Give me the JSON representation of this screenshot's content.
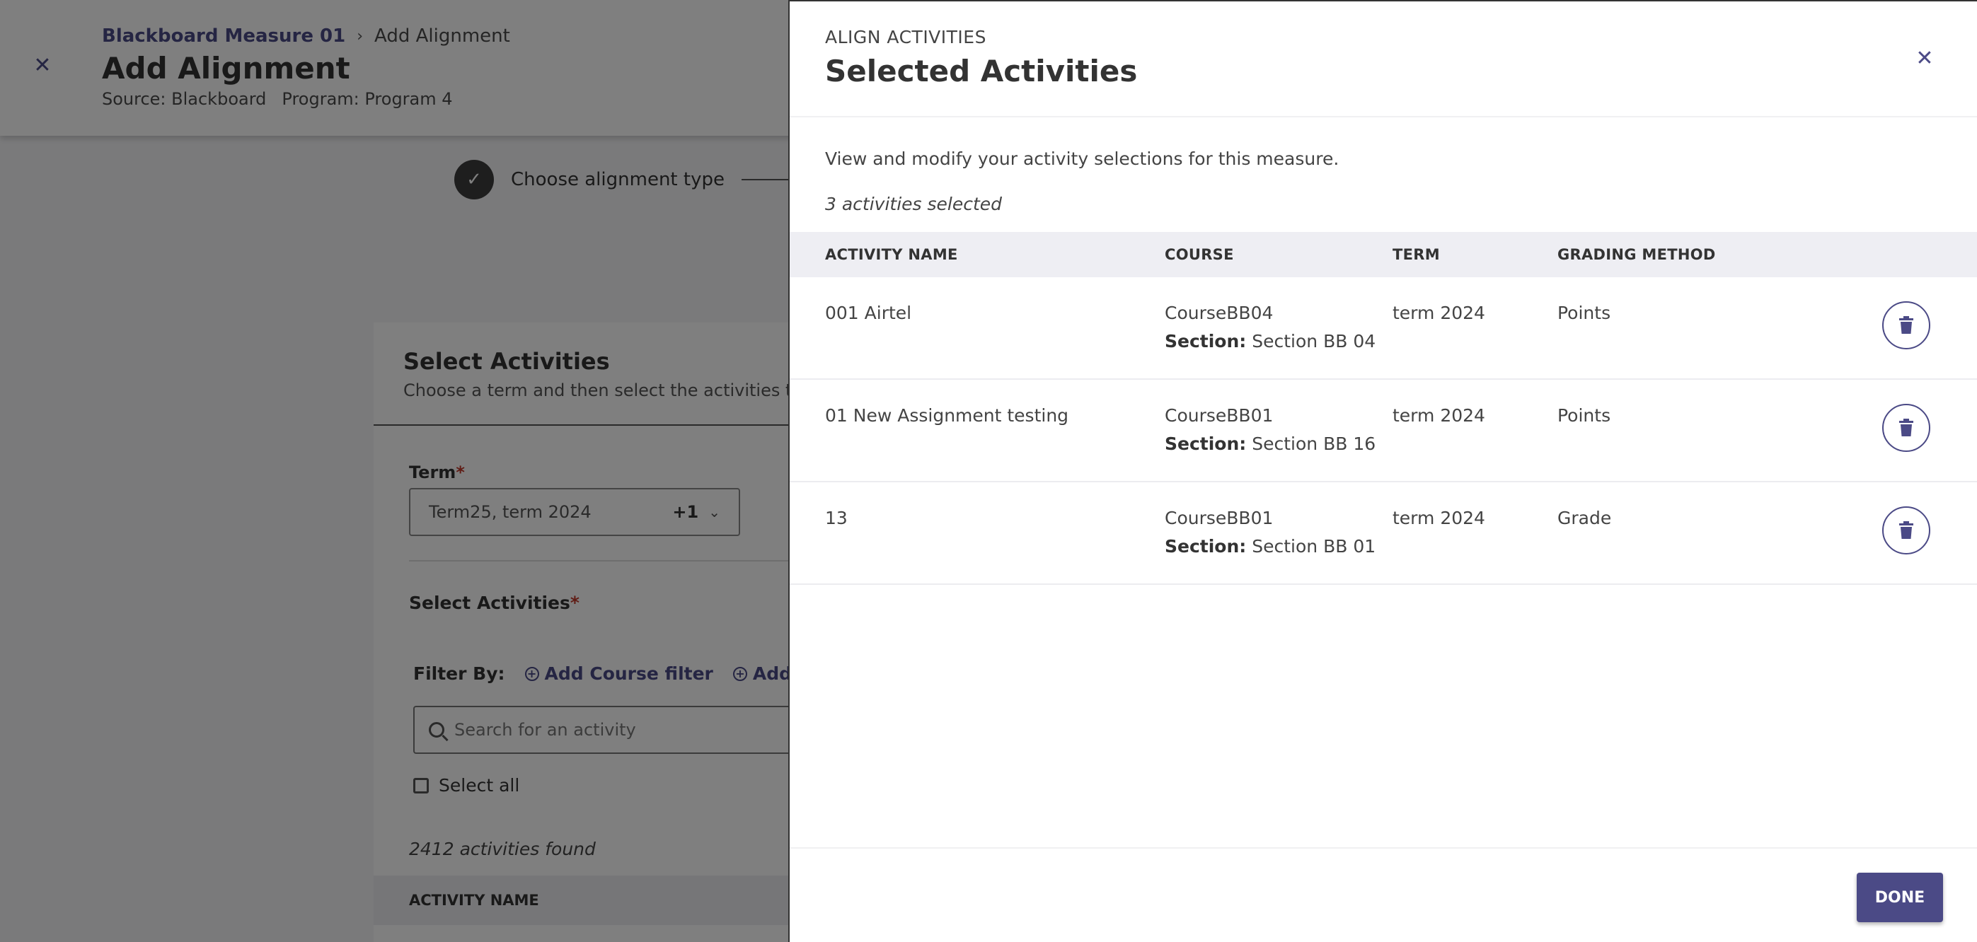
{
  "background": {
    "breadcrumb": {
      "parent": "Blackboard Measure 01",
      "separator": "›",
      "current": "Add Alignment"
    },
    "title": "Add Alignment",
    "meta": {
      "source": "Source: Blackboard",
      "program": "Program: Program 4"
    },
    "stepper": {
      "step1_label": "Choose alignment type",
      "step1_icon": "check-icon"
    },
    "card": {
      "title": "Select Activities",
      "subtitle": "Choose a term and then select the activities that",
      "term_label": "Term",
      "term_value": "Term25, term 2024",
      "term_extra": "+1",
      "select_label": "Select Activities",
      "filter_label": "Filter By:",
      "filter_course": "Add Course filter",
      "filter_section": "Add Secti",
      "search_placeholder": "Search for an activity",
      "select_all": "Select all",
      "found": "2412 activities found",
      "col_name": "ACTIVITY NAME"
    }
  },
  "panel": {
    "eyebrow": "ALIGN ACTIVITIES",
    "title": "Selected Activities",
    "description": "View and modify your activity selections for this measure.",
    "count": "3 activities selected",
    "columns": {
      "name": "ACTIVITY NAME",
      "course": "COURSE",
      "term": "TERM",
      "grading": "GRADING METHOD"
    },
    "section_label": "Section:",
    "rows": [
      {
        "name": "001 Airtel",
        "course": "CourseBB04",
        "section": "Section BB 04",
        "term": "term 2024",
        "grading": "Points"
      },
      {
        "name": "01 New Assignment testing",
        "course": "CourseBB01",
        "section": "Section BB 16",
        "term": "term 2024",
        "grading": "Points"
      },
      {
        "name": "13",
        "course": "CourseBB01",
        "section": "Section BB 01",
        "term": "term 2024",
        "grading": "Grade"
      }
    ],
    "done_label": "DONE",
    "accent": "#4b4a86"
  }
}
